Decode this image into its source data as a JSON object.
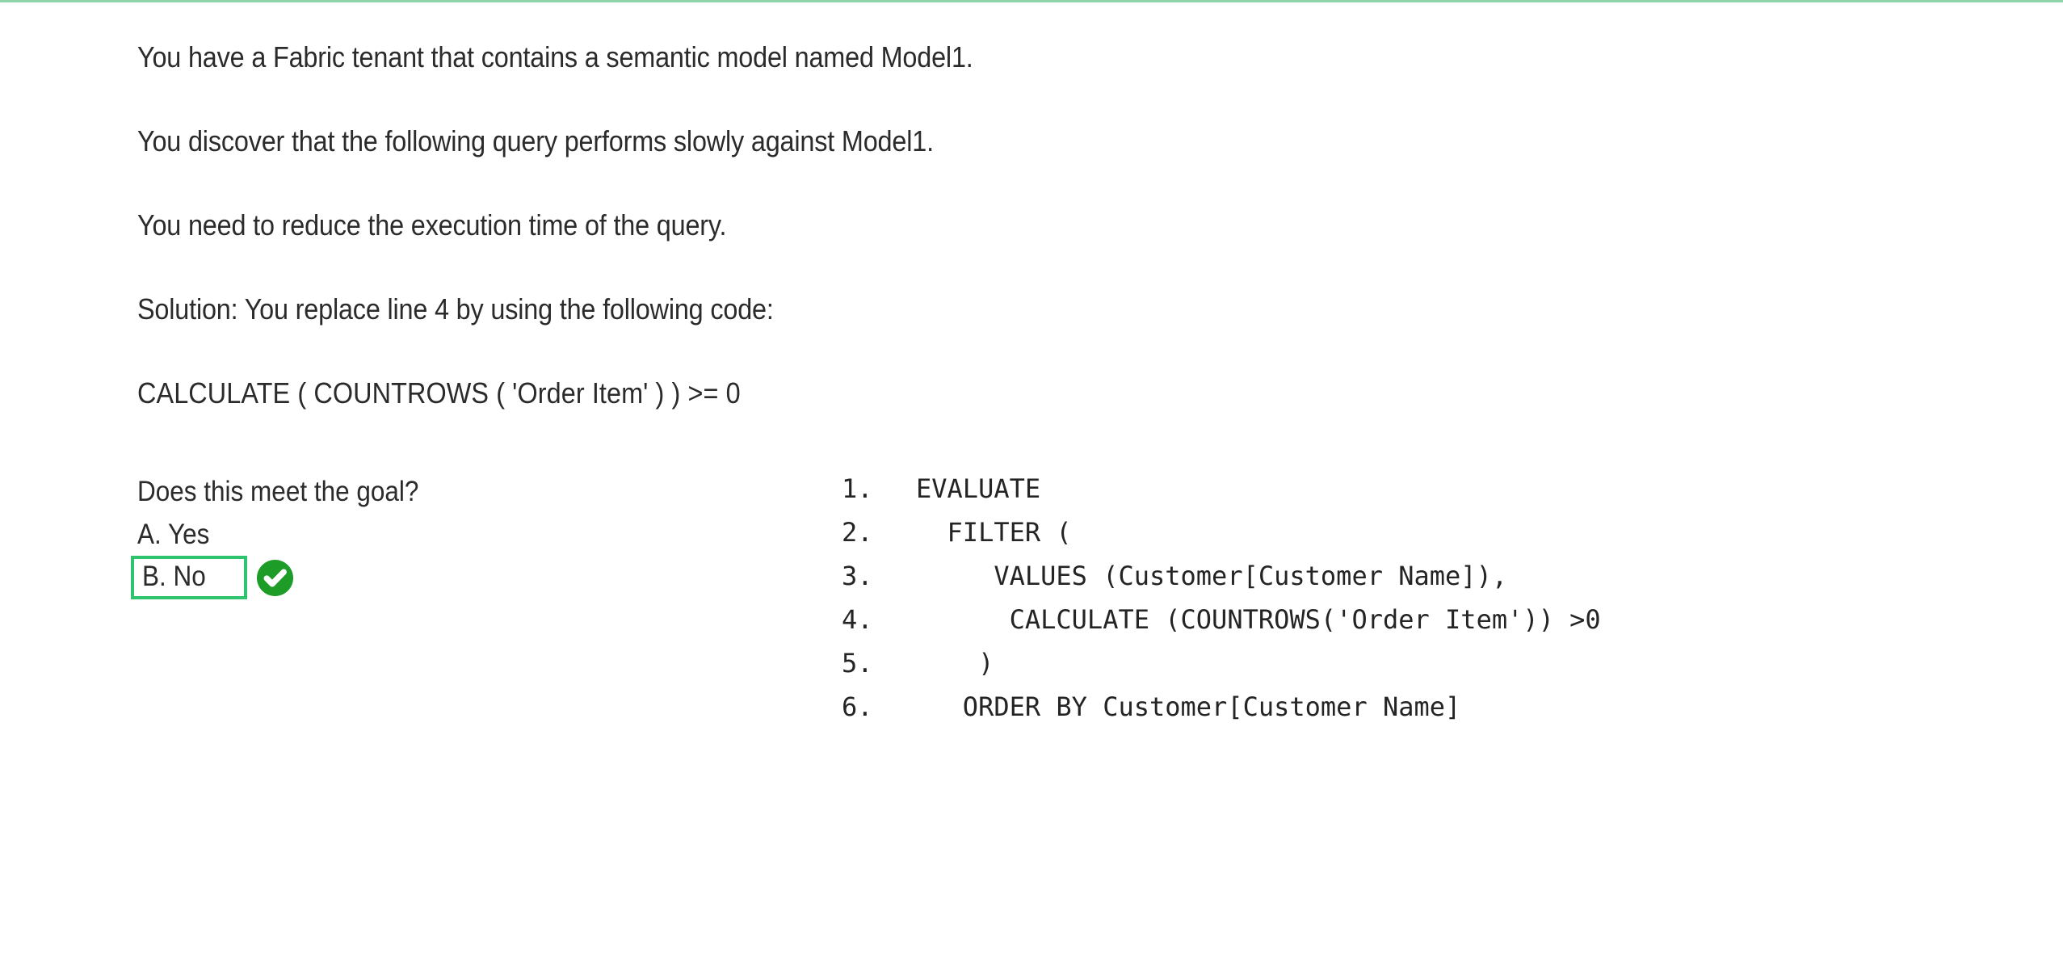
{
  "document": {
    "type": "exam-question-screenshot",
    "prose": [
      "You have a Fabric tenant that contains a semantic model named Model1.",
      "You discover that the following query performs slowly against Model1.",
      "You need to reduce the execution time of the query.",
      "Solution: You replace line 4 by using the following code:",
      "CALCULATE ( COUNTROWS ( 'Order Item' ) ) >= 0"
    ],
    "question": {
      "prompt": "Does this meet the goal?",
      "options": [
        {
          "id": "A",
          "label": "A. Yes",
          "selected": false,
          "correct": false
        },
        {
          "id": "B",
          "label": "B. No",
          "selected": true,
          "correct": true
        }
      ],
      "correct_marker_icon": "check-circle-icon"
    },
    "code_listing": {
      "language": "DAX",
      "lines": [
        {
          "number": "1.",
          "text": "EVALUATE"
        },
        {
          "number": "2.",
          "text": "  FILTER ("
        },
        {
          "number": "3.",
          "text": "     VALUES (Customer[Customer Name]),"
        },
        {
          "number": "4.",
          "text": "      CALCULATE (COUNTROWS('Order Item')) >0"
        },
        {
          "number": "5.",
          "text": "    )"
        },
        {
          "number": "6.",
          "text": "   ORDER BY Customer[Customer Name]"
        }
      ]
    },
    "colors": {
      "page_background": "#ffffff",
      "body_text": "#2b2b2b",
      "code_text": "#242424",
      "highlight_box_border": "#2ec46f",
      "check_circle_fill": "#1d9c28",
      "check_mark": "#ffffff",
      "top_edge_line": "#8ed4a8"
    }
  }
}
